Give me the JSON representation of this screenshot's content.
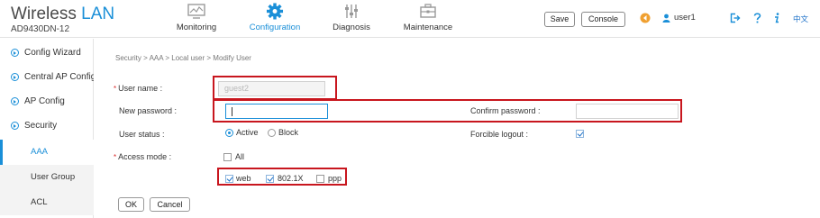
{
  "brand": {
    "title_main": "Wireless",
    "title_accent": "LAN",
    "model": "AD9430DN-12"
  },
  "nav": {
    "items": [
      {
        "label": "Monitoring",
        "icon": "monitor-icon"
      },
      {
        "label": "Configuration",
        "icon": "gear-icon",
        "active": true
      },
      {
        "label": "Diagnosis",
        "icon": "sliders-icon"
      },
      {
        "label": "Maintenance",
        "icon": "toolbox-icon"
      }
    ]
  },
  "header": {
    "save_label": "Save",
    "console_label": "Console",
    "user_name": "user1",
    "lang_label": "中文",
    "icons": [
      "alarm-icon",
      "user-icon",
      "logout-icon",
      "help-icon",
      "info-icon"
    ]
  },
  "sidebar": {
    "items": [
      {
        "label": "Config Wizard"
      },
      {
        "label": "Central AP Config"
      },
      {
        "label": "AP Config"
      },
      {
        "label": "Security"
      }
    ],
    "sub_items": [
      {
        "label": "AAA",
        "active": true
      },
      {
        "label": "User Group"
      },
      {
        "label": "ACL"
      }
    ]
  },
  "breadcrumb": "Security > AAA > Local user > Modify User",
  "form": {
    "user_name_label": "User name :",
    "user_name_value": "guest2",
    "new_password_label": "New password :",
    "new_password_value": "",
    "confirm_password_label": "Confirm password :",
    "confirm_password_value": "",
    "user_status_label": "User status :",
    "status_active": "Active",
    "status_block": "Block",
    "forcible_logout_label": "Forcible logout :",
    "access_mode_label": "Access mode :",
    "all_label": "All",
    "mode_web": "web",
    "mode_8021x": "802.1X",
    "mode_ppp": "ppp",
    "required_mark": "*"
  },
  "actions": {
    "ok_label": "OK",
    "cancel_label": "Cancel"
  },
  "colors": {
    "accent": "#1a8fd8",
    "highlight": "#c8161e",
    "alarm": "#f0a030"
  }
}
